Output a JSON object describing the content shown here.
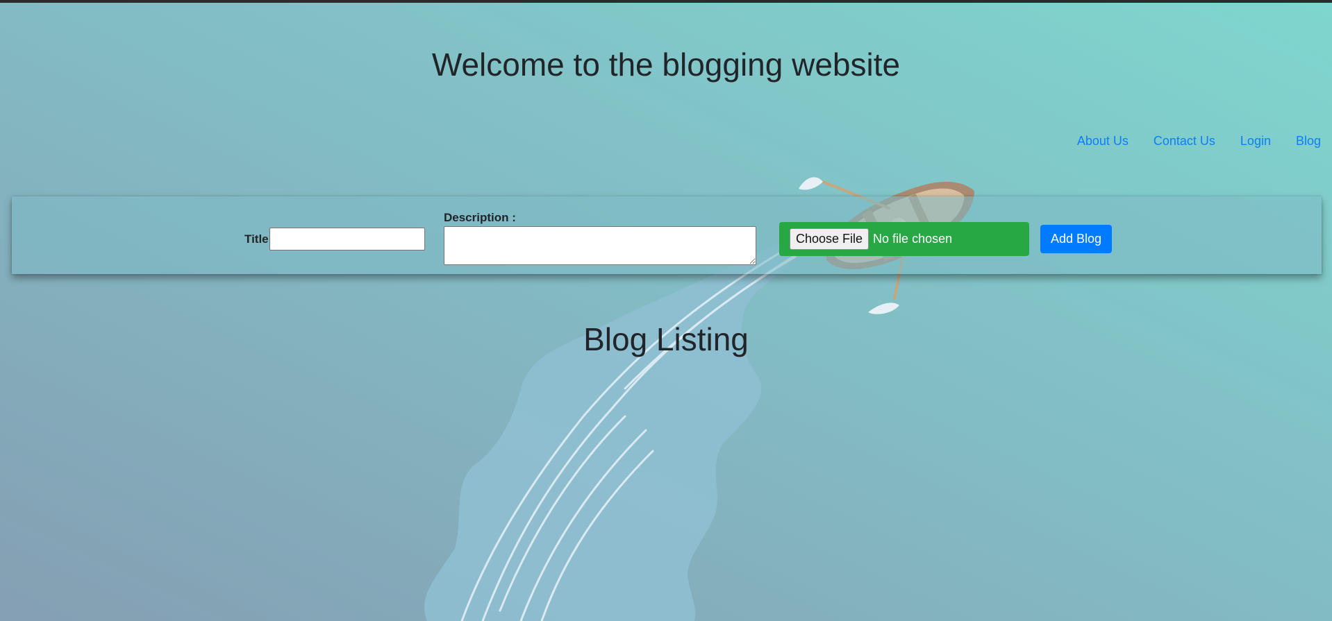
{
  "header": {
    "title": "Welcome to the blogging website"
  },
  "nav": {
    "items": [
      "About Us",
      "Contact Us",
      "Login",
      "Blog"
    ]
  },
  "form": {
    "title_label": "Title :",
    "title_value": "",
    "description_label": "Description :",
    "description_value": "",
    "file_button_label": "Choose File",
    "file_status": "No file chosen",
    "submit_label": "Add Blog"
  },
  "listing": {
    "title": "Blog Listing"
  },
  "colors": {
    "link": "#0d7ff5",
    "file_bg": "#28a745",
    "primary_button": "#007bff",
    "text": "#212529"
  },
  "icons": {
    "background_illustration": "rowboat-wake-illustration"
  }
}
